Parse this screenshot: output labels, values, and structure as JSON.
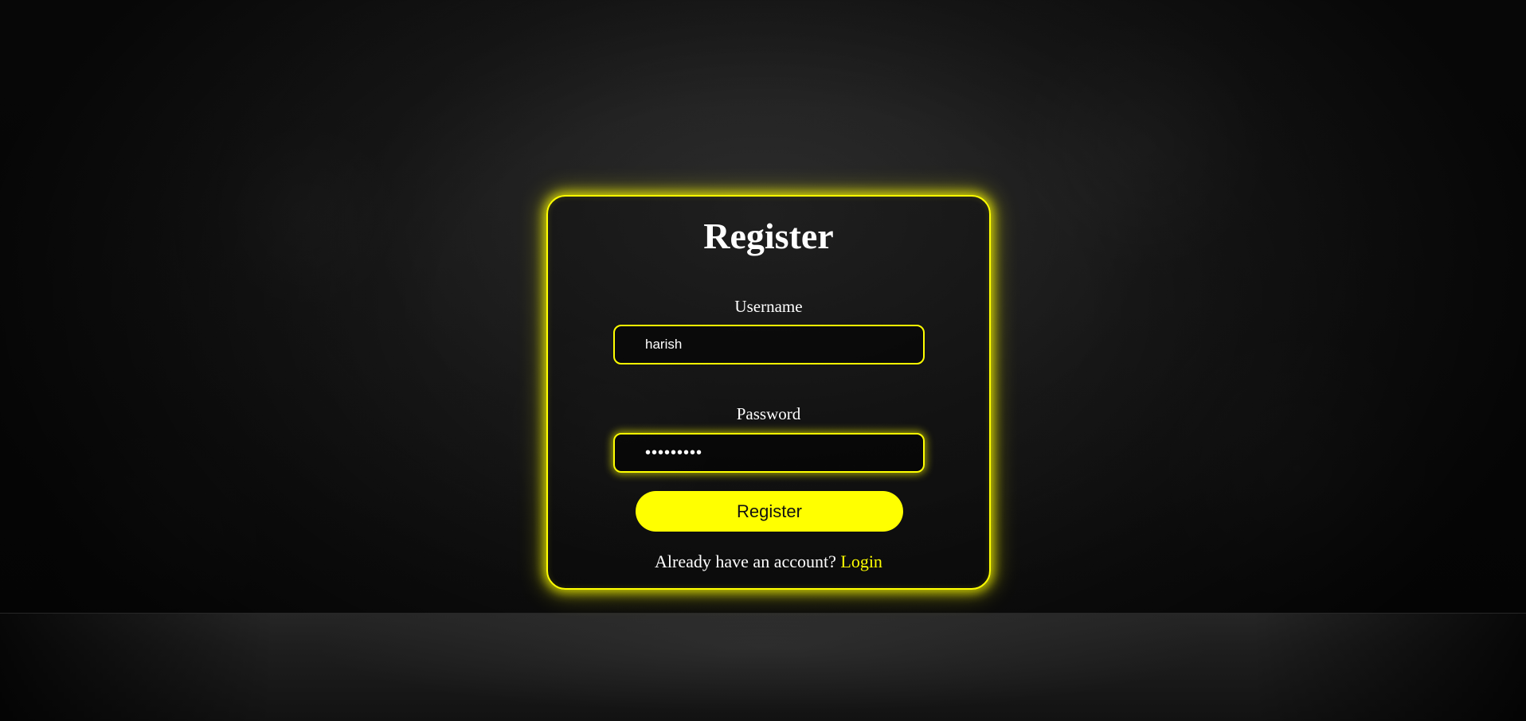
{
  "colors": {
    "accent": "#ffff00",
    "background": "#151515",
    "text": "#ffffff"
  },
  "form": {
    "title": "Register",
    "username": {
      "label": "Username",
      "value": "harish"
    },
    "password": {
      "label": "Password",
      "masked_value": "•••••••••"
    },
    "submit_label": "Register",
    "footer": {
      "prompt": "Already have an account?",
      "link_label": "Login"
    }
  }
}
